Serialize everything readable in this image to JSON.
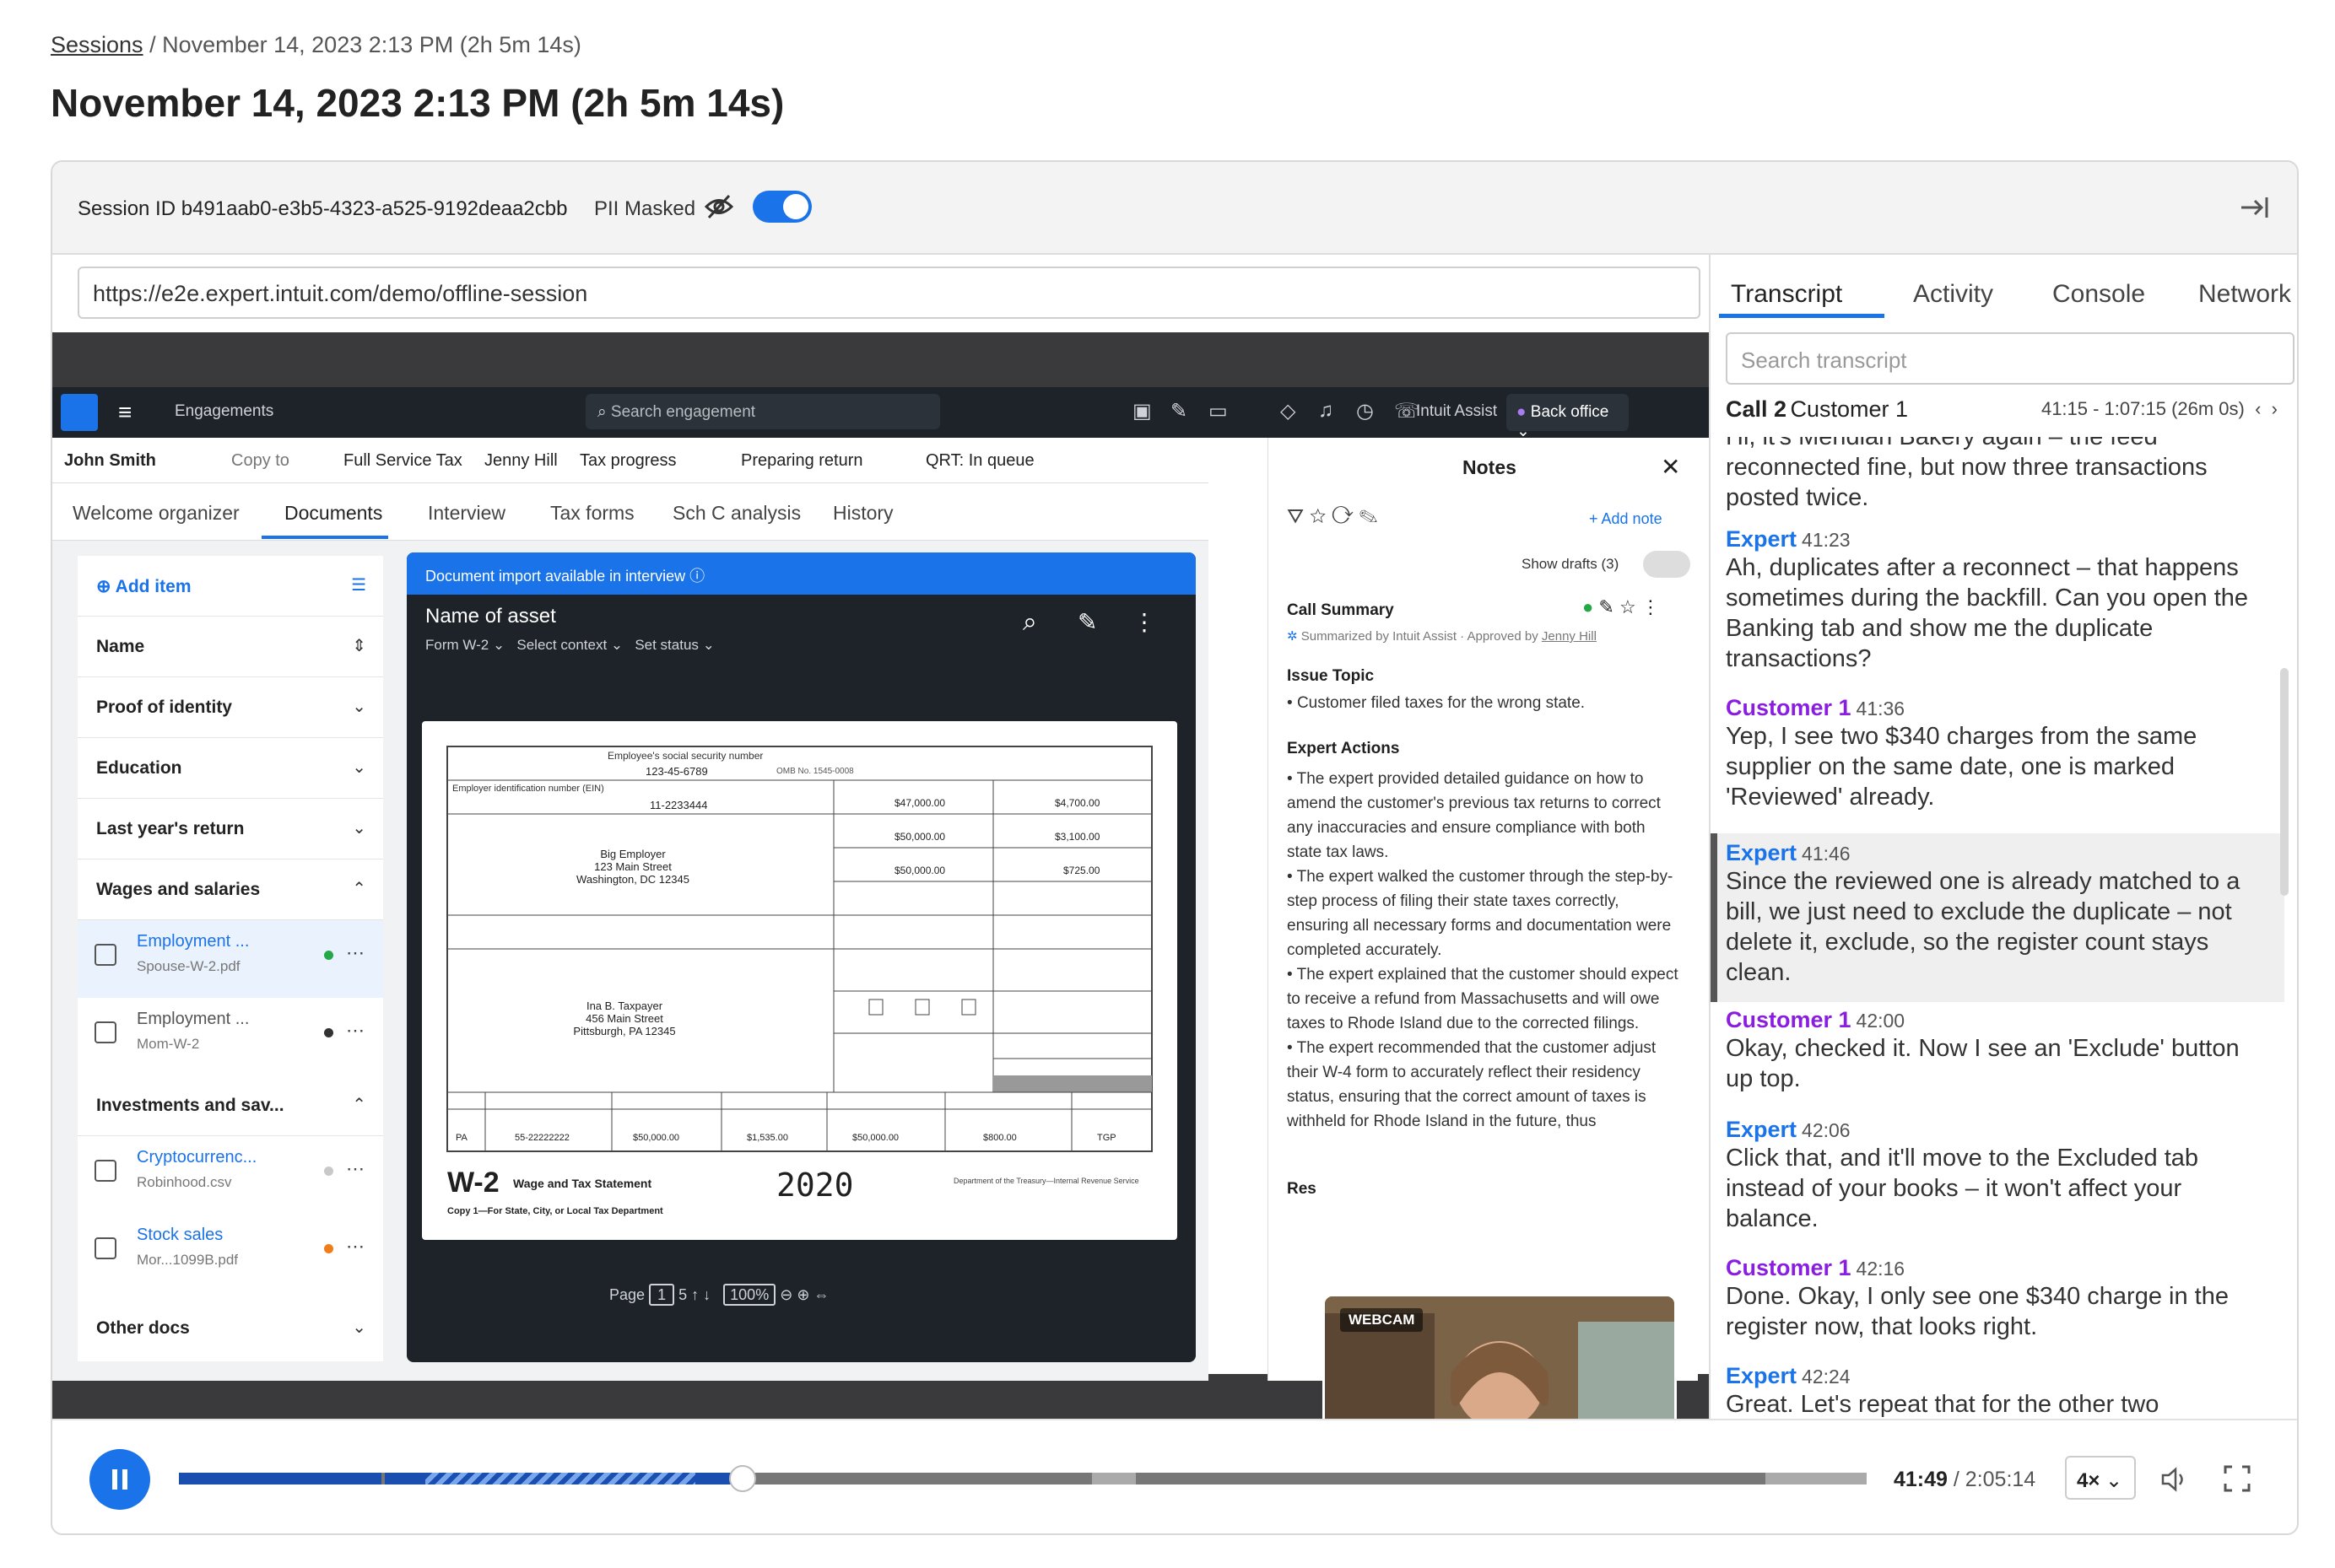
{
  "breadcrumb": {
    "link": "Sessions",
    "rest": "/ November 14, 2023 2:13 PM (2h 5m 14s)"
  },
  "page_title": "November 14, 2023 2:13 PM (2h 5m 14s)",
  "session": {
    "id_text": "Session ID b491aab0-e3b5-4323-a525-9192deaa2cbb",
    "pii_label": "PII Masked",
    "pii_on": true
  },
  "url": "https://e2e.expert.intuit.com/demo/offline-session",
  "app": {
    "engagements": "Engagements",
    "search_placeholder": "Search engagement",
    "assist": "Intuit Assist",
    "back_office": "Back office",
    "context": [
      "John Smith",
      "Copy to",
      "Full Service Tax",
      "Jenny Hill",
      "Tax progress",
      "Preparing return",
      "QRT: In queue"
    ],
    "tabs": [
      "Welcome organizer",
      "Documents",
      "Interview",
      "Tax forms",
      "Sch C analysis",
      "History"
    ],
    "active_tab": "Documents",
    "add_item": "Add item",
    "sections": [
      "Name",
      "Proof of identity",
      "Education",
      "Last year's return",
      "Wages and salaries",
      "Investments and sav...",
      "Other docs"
    ],
    "files": [
      {
        "name": "Employment ...",
        "sub": "Spouse-W-2.pdf",
        "dot": "#22a845"
      },
      {
        "name": "Employment ...",
        "sub": "Mom-W-2",
        "dot": "#333333"
      },
      {
        "name": "Cryptocurrenc...",
        "sub": "Robinhood.csv",
        "dot": "#c8c8c8"
      },
      {
        "name": "Stock sales",
        "sub": "Mor...1099B.pdf",
        "dot": "#f07d19"
      }
    ],
    "viewer": {
      "banner": "Document import available in interview",
      "asset_title": "Name of asset",
      "asset_sub": [
        "Form W-2",
        "Select context",
        "Set status"
      ],
      "page_label": "Page",
      "page_num": "1",
      "page_total": "5",
      "zoom": "100%"
    },
    "w2": {
      "ssn_label": "Employee's social security number",
      "ssn": "123-45-6789",
      "omb": "OMB No. 1545-0008",
      "ein_label": "Employer identification number (EIN)",
      "ein": "11-2233444",
      "employer": [
        "Big Employer",
        "123 Main Street",
        "Washington, DC 12345"
      ],
      "employee": [
        "Ina B. Taxpayer",
        "456 Main Street",
        "Pittsburgh, PA 12345"
      ],
      "box1": "$47,000.00",
      "box2": "$4,700.00",
      "box3": "$50,000.00",
      "box4": "$3,100.00",
      "box5": "$50,000.00",
      "box6": "$725.00",
      "state": "PA",
      "state_id": "55-22222222",
      "st_wages": "$50,000.00",
      "st_tax": "$1,535.00",
      "loc_wages": "$50,000.00",
      "loc_tax": "$800.00",
      "loc_name": "TGP",
      "form": "W-2",
      "form_title": "Wage and Tax Statement",
      "year": "2020",
      "copy": "Copy 1—For State, City, or Local Tax Department",
      "dept": "Department of the Treasury—Internal Revenue Service"
    },
    "notes": {
      "title": "Notes",
      "add_note": "Add note",
      "show_drafts": "Show drafts (3)",
      "call_summary": "Call Summary",
      "summarized_by": "Summarized by Intuit Assist · Approved by",
      "approver": "Jenny Hill",
      "issue_topic": "Issue Topic",
      "issue": "Customer filed taxes for the wrong state.",
      "expert_actions": "Expert Actions",
      "actions": [
        "The expert provided detailed guidance on how to amend the customer's previous tax returns to correct any inaccuracies and ensure compliance with both state tax laws.",
        "The expert walked the customer through the step-by-step process of filing their state taxes correctly, ensuring all necessary forms and documentation were completed accurately.",
        "The expert explained that the customer should expect to receive a refund from Massachusetts and will owe taxes to Rhode Island due to the corrected filings.",
        "The expert recommended that the customer adjust their W-4 form to accurately reflect their residency status, ensuring that the correct amount of taxes is withheld for Rhode Island in the future, thus"
      ],
      "res_partial": "Res"
    },
    "webcam_label": "WEBCAM"
  },
  "right_panel": {
    "tabs": [
      "Transcript",
      "Activity",
      "Console",
      "Network"
    ],
    "active_tab": "Transcript",
    "search_placeholder": "Search transcript",
    "call": {
      "name": "Call 2",
      "who": "Customer 1",
      "time": "41:15 - 1:07:15 (26m 0s)"
    },
    "messages": [
      {
        "speaker": "",
        "time": "",
        "text": "Hi, it's Meridian Bakery again – the feed reconnected fine, but now three transactions posted twice.",
        "role": "customer"
      },
      {
        "speaker": "Expert",
        "time": "41:23",
        "text": "Ah, duplicates after a reconnect – that happens sometimes during the backfill. Can you open the Banking tab and show me the duplicate transactions?",
        "role": "expert"
      },
      {
        "speaker": "Customer 1",
        "time": "41:36",
        "text": "Yep, I see two $340 charges from the same supplier on the same date, one is marked 'Reviewed' already.",
        "role": "customer"
      },
      {
        "speaker": "Expert",
        "time": "41:46",
        "text": "Since the reviewed one is already matched to a bill, we just need to exclude the duplicate – not delete it, exclude, so the register count stays clean.",
        "role": "expert",
        "highlight": true
      },
      {
        "speaker": "Customer 1",
        "time": "42:00",
        "text": "Okay, checked it. Now I see an 'Exclude' button up top.",
        "role": "customer"
      },
      {
        "speaker": "Expert",
        "time": "42:06",
        "text": "Click that, and it'll move to the Excluded tab instead of your books – it won't affect your balance.",
        "role": "expert"
      },
      {
        "speaker": "Customer 1",
        "time": "42:16",
        "text": "Done. Okay, I only see one $340 charge in the register now, that looks right.",
        "role": "customer"
      },
      {
        "speaker": "Expert",
        "time": "42:24",
        "text": "Great. Let's repeat that for the other two",
        "role": "expert"
      }
    ]
  },
  "player": {
    "current": "41:49",
    "total": "/ 2:05:14",
    "speed": "4×",
    "progress_fraction": 0.334,
    "playing": true
  },
  "colors": {
    "accent": "#1a73e8",
    "customer": "#8a1ee0",
    "dark_nav": "#1e2329"
  }
}
